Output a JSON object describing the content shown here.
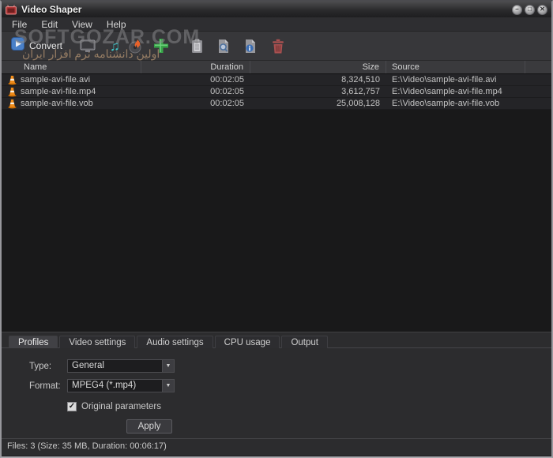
{
  "window": {
    "title": "Video Shaper"
  },
  "menu": {
    "items": [
      "File",
      "Edit",
      "View",
      "Help"
    ]
  },
  "toolbar": {
    "convert_label": "Convert",
    "icon_names": [
      "convert-icon",
      "video-preview-icon",
      "audio-note-icon",
      "burn-disc-icon",
      "add-file-icon",
      "paste-icon",
      "search-file-icon",
      "file-info-icon",
      "delete-icon"
    ]
  },
  "watermark": {
    "line1": "SOFTGOZAR.COM",
    "line2": "اولین دانشنامه نرم افزار ایران"
  },
  "table": {
    "columns": [
      {
        "label": "Name"
      },
      {
        "label": "Duration"
      },
      {
        "label": "Size"
      },
      {
        "label": "Source"
      },
      {
        "label": ""
      }
    ],
    "rows": [
      {
        "name": "sample-avi-file.avi",
        "duration": "00:02:05",
        "size": "8,324,510",
        "source": "E:\\Video\\sample-avi-file.avi"
      },
      {
        "name": "sample-avi-file.mp4",
        "duration": "00:02:05",
        "size": "3,612,757",
        "source": "E:\\Video\\sample-avi-file.mp4"
      },
      {
        "name": "sample-avi-file.vob",
        "duration": "00:02:05",
        "size": "25,008,128",
        "source": "E:\\Video\\sample-avi-file.vob"
      }
    ]
  },
  "tabs": {
    "items": [
      "Profiles",
      "Video settings",
      "Audio settings",
      "CPU usage",
      "Output"
    ],
    "active_index": 0
  },
  "profiles_panel": {
    "type_label": "Type:",
    "type_value": "General",
    "format_label": "Format:",
    "format_value": "MPEG4 (*.mp4)",
    "checkbox_label": "Original parameters",
    "checkbox_checked": true,
    "apply_label": "Apply"
  },
  "status_bar": {
    "text": "Files: 3 (Size: 35 MB, Duration: 00:06:17)"
  },
  "colors": {
    "accent_blue": "#4a80c8",
    "icon_teal": "#3fc6c9",
    "icon_green": "#38a449",
    "icon_orange": "#e8622a",
    "icon_red": "#a85050",
    "cone_orange": "#f08c1a"
  }
}
